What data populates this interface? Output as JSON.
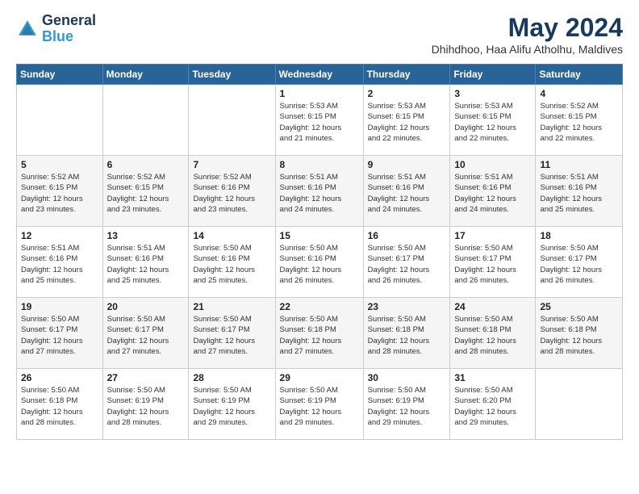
{
  "logo": {
    "line1": "General",
    "line2": "Blue"
  },
  "title": "May 2024",
  "location": "Dhihdhoo, Haa Alifu Atholhu, Maldives",
  "days_of_week": [
    "Sunday",
    "Monday",
    "Tuesday",
    "Wednesday",
    "Thursday",
    "Friday",
    "Saturday"
  ],
  "weeks": [
    [
      {
        "day": "",
        "info": ""
      },
      {
        "day": "",
        "info": ""
      },
      {
        "day": "",
        "info": ""
      },
      {
        "day": "1",
        "info": "Sunrise: 5:53 AM\nSunset: 6:15 PM\nDaylight: 12 hours\nand 21 minutes."
      },
      {
        "day": "2",
        "info": "Sunrise: 5:53 AM\nSunset: 6:15 PM\nDaylight: 12 hours\nand 22 minutes."
      },
      {
        "day": "3",
        "info": "Sunrise: 5:53 AM\nSunset: 6:15 PM\nDaylight: 12 hours\nand 22 minutes."
      },
      {
        "day": "4",
        "info": "Sunrise: 5:52 AM\nSunset: 6:15 PM\nDaylight: 12 hours\nand 22 minutes."
      }
    ],
    [
      {
        "day": "5",
        "info": "Sunrise: 5:52 AM\nSunset: 6:15 PM\nDaylight: 12 hours\nand 23 minutes."
      },
      {
        "day": "6",
        "info": "Sunrise: 5:52 AM\nSunset: 6:15 PM\nDaylight: 12 hours\nand 23 minutes."
      },
      {
        "day": "7",
        "info": "Sunrise: 5:52 AM\nSunset: 6:16 PM\nDaylight: 12 hours\nand 23 minutes."
      },
      {
        "day": "8",
        "info": "Sunrise: 5:51 AM\nSunset: 6:16 PM\nDaylight: 12 hours\nand 24 minutes."
      },
      {
        "day": "9",
        "info": "Sunrise: 5:51 AM\nSunset: 6:16 PM\nDaylight: 12 hours\nand 24 minutes."
      },
      {
        "day": "10",
        "info": "Sunrise: 5:51 AM\nSunset: 6:16 PM\nDaylight: 12 hours\nand 24 minutes."
      },
      {
        "day": "11",
        "info": "Sunrise: 5:51 AM\nSunset: 6:16 PM\nDaylight: 12 hours\nand 25 minutes."
      }
    ],
    [
      {
        "day": "12",
        "info": "Sunrise: 5:51 AM\nSunset: 6:16 PM\nDaylight: 12 hours\nand 25 minutes."
      },
      {
        "day": "13",
        "info": "Sunrise: 5:51 AM\nSunset: 6:16 PM\nDaylight: 12 hours\nand 25 minutes."
      },
      {
        "day": "14",
        "info": "Sunrise: 5:50 AM\nSunset: 6:16 PM\nDaylight: 12 hours\nand 25 minutes."
      },
      {
        "day": "15",
        "info": "Sunrise: 5:50 AM\nSunset: 6:16 PM\nDaylight: 12 hours\nand 26 minutes."
      },
      {
        "day": "16",
        "info": "Sunrise: 5:50 AM\nSunset: 6:17 PM\nDaylight: 12 hours\nand 26 minutes."
      },
      {
        "day": "17",
        "info": "Sunrise: 5:50 AM\nSunset: 6:17 PM\nDaylight: 12 hours\nand 26 minutes."
      },
      {
        "day": "18",
        "info": "Sunrise: 5:50 AM\nSunset: 6:17 PM\nDaylight: 12 hours\nand 26 minutes."
      }
    ],
    [
      {
        "day": "19",
        "info": "Sunrise: 5:50 AM\nSunset: 6:17 PM\nDaylight: 12 hours\nand 27 minutes."
      },
      {
        "day": "20",
        "info": "Sunrise: 5:50 AM\nSunset: 6:17 PM\nDaylight: 12 hours\nand 27 minutes."
      },
      {
        "day": "21",
        "info": "Sunrise: 5:50 AM\nSunset: 6:17 PM\nDaylight: 12 hours\nand 27 minutes."
      },
      {
        "day": "22",
        "info": "Sunrise: 5:50 AM\nSunset: 6:18 PM\nDaylight: 12 hours\nand 27 minutes."
      },
      {
        "day": "23",
        "info": "Sunrise: 5:50 AM\nSunset: 6:18 PM\nDaylight: 12 hours\nand 28 minutes."
      },
      {
        "day": "24",
        "info": "Sunrise: 5:50 AM\nSunset: 6:18 PM\nDaylight: 12 hours\nand 28 minutes."
      },
      {
        "day": "25",
        "info": "Sunrise: 5:50 AM\nSunset: 6:18 PM\nDaylight: 12 hours\nand 28 minutes."
      }
    ],
    [
      {
        "day": "26",
        "info": "Sunrise: 5:50 AM\nSunset: 6:18 PM\nDaylight: 12 hours\nand 28 minutes."
      },
      {
        "day": "27",
        "info": "Sunrise: 5:50 AM\nSunset: 6:19 PM\nDaylight: 12 hours\nand 28 minutes."
      },
      {
        "day": "28",
        "info": "Sunrise: 5:50 AM\nSunset: 6:19 PM\nDaylight: 12 hours\nand 29 minutes."
      },
      {
        "day": "29",
        "info": "Sunrise: 5:50 AM\nSunset: 6:19 PM\nDaylight: 12 hours\nand 29 minutes."
      },
      {
        "day": "30",
        "info": "Sunrise: 5:50 AM\nSunset: 6:19 PM\nDaylight: 12 hours\nand 29 minutes."
      },
      {
        "day": "31",
        "info": "Sunrise: 5:50 AM\nSunset: 6:20 PM\nDaylight: 12 hours\nand 29 minutes."
      },
      {
        "day": "",
        "info": ""
      }
    ]
  ]
}
